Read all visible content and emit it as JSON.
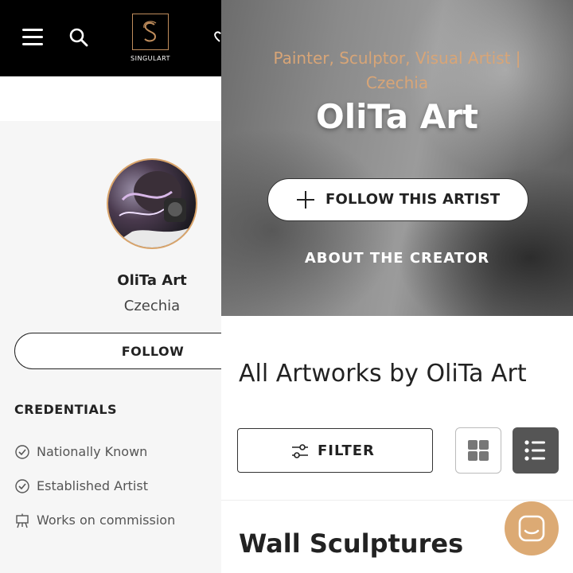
{
  "header": {
    "logo_text": "SINGULART",
    "logo_letter": "S"
  },
  "profile": {
    "name": "OliTa Art",
    "country": "Czechia",
    "follow_label": "FOLLOW"
  },
  "credentials": {
    "title": "CREDENTIALS",
    "items": [
      {
        "label": "Nationally Known",
        "icon": "check-circle-icon"
      },
      {
        "label": "Established Artist",
        "icon": "check-circle-icon"
      },
      {
        "label": "Works on commission",
        "icon": "easel-icon"
      }
    ]
  },
  "hero": {
    "roles": "Painter, Sculptor, Visual Artist | Czechia",
    "name": "OliTa Art",
    "follow_label": "FOLLOW THIS ARTIST",
    "about_label": "ABOUT THE CREATOR"
  },
  "artworks": {
    "title": "All Artworks by OliTa Art",
    "filter_label": "FILTER",
    "section_title": "Wall Sculptures"
  },
  "colors": {
    "accent": "#d9a46a",
    "header_bg": "#000000",
    "active_toggle": "#555555"
  }
}
